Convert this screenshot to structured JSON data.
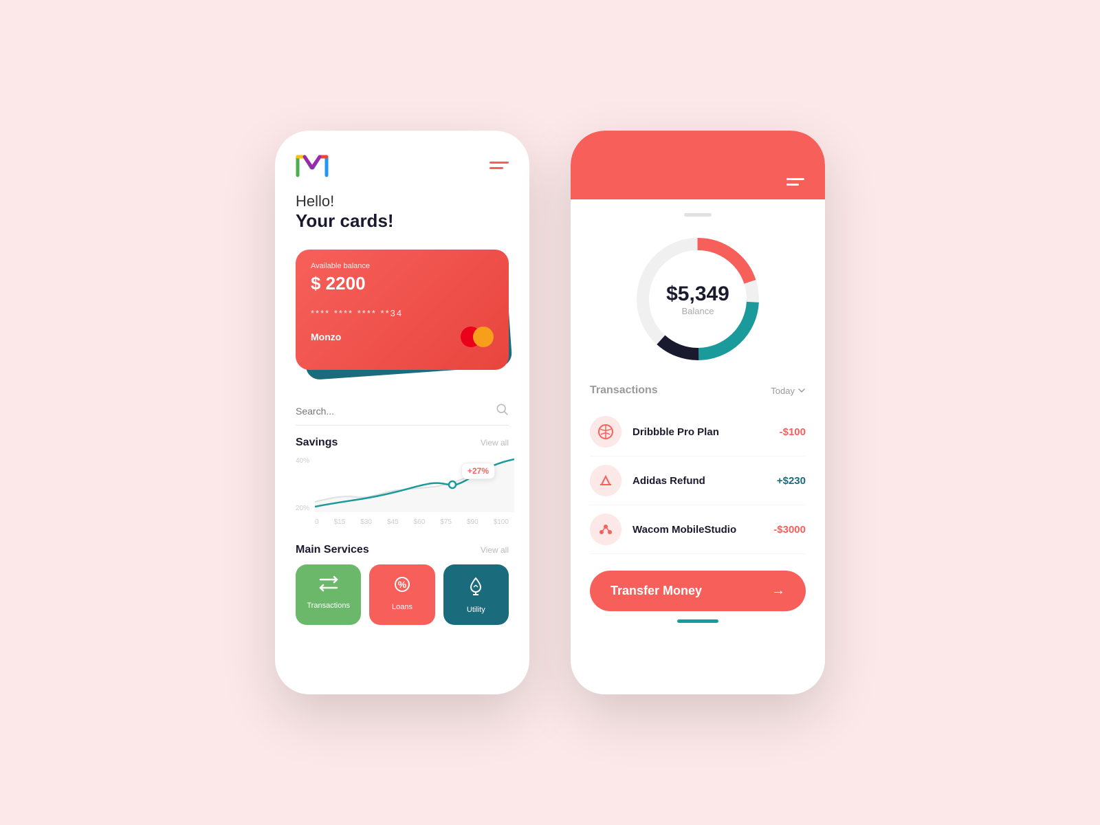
{
  "background": "#fce8e8",
  "phone1": {
    "greeting_line1": "Hello!",
    "greeting_line2": "Your cards!",
    "card": {
      "label": "Available balance",
      "balance": "$ 2200",
      "number": "****  ****  ****  **34",
      "name": "Monzo"
    },
    "search_placeholder": "Search...",
    "savings_title": "Savings",
    "savings_view_all": "View all",
    "chart_tooltip": "+27%",
    "chart_y_labels": [
      "40%",
      "20%"
    ],
    "chart_x_labels": [
      "0",
      "$15",
      "$30",
      "$45",
      "$60",
      "$75",
      "$90",
      "$100"
    ],
    "services_title": "Main Services",
    "services_view_all": "View all",
    "services": [
      {
        "label": "Transactions",
        "color": "green"
      },
      {
        "label": "Loans",
        "color": "red"
      },
      {
        "label": "Utility",
        "color": "teal"
      }
    ]
  },
  "phone2": {
    "balance_amount": "$5,349",
    "balance_label": "Balance",
    "transactions_title": "Transactions",
    "transactions_filter": "Today",
    "transactions": [
      {
        "name": "Dribbble Pro Plan",
        "amount": "-$100",
        "type": "negative"
      },
      {
        "name": "Adidas Refund",
        "amount": "+$230",
        "type": "positive"
      },
      {
        "name": "Wacom MobileStudio",
        "amount": "-$3000",
        "type": "negative"
      }
    ],
    "transfer_button_label": "Transfer Money"
  }
}
